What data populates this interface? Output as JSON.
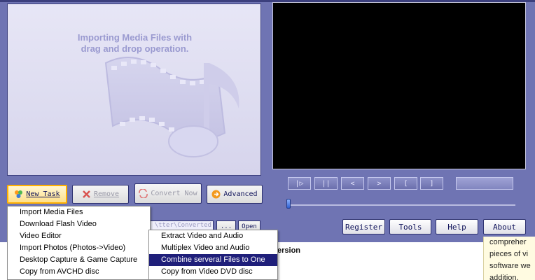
{
  "import_panel": {
    "message": "Importing Media Files with\ndrag and drop operation."
  },
  "toolbar": {
    "new_task": "New Task",
    "remove": "Remove",
    "convert_now": "Convert Now",
    "advanced": "Advanced"
  },
  "playback": {
    "buttons": [
      "|▷",
      "||",
      "<",
      ">",
      "[",
      "]"
    ],
    "seek_position": 0
  },
  "output": {
    "path": "tter\\Converted\\",
    "dots_label": "...",
    "open_label": "Open"
  },
  "bottom_buttons": {
    "register": "Register",
    "tools": "Tools",
    "help": "Help",
    "about": "About"
  },
  "new_task_menu": [
    "Import Media Files",
    "Download Flash Video",
    "Video Editor",
    "Import Photos (Photos->Video)",
    "Desktop Capture & Game Capture",
    "Copy from AVCHD disc"
  ],
  "submenu": {
    "items": [
      "Extract Video and Audio",
      "Multiplex Video and Audio",
      "Combine serveral Files to One",
      "Copy from Video DVD disc"
    ],
    "highlighted_index": 2
  },
  "webpage": {
    "heading_fragment": "ersion",
    "side_lines": [
      "compreher",
      "pieces of vi",
      "software we",
      "addition,"
    ]
  },
  "colors": {
    "app_background": "#6f74b3",
    "menu_highlight": "#1f1f7a",
    "selected_button_border": "#ffb000"
  }
}
